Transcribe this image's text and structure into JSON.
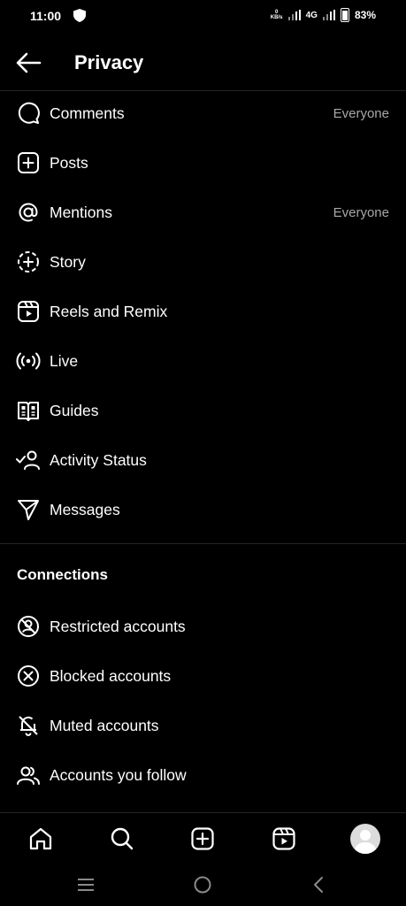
{
  "status_bar": {
    "time": "11:00",
    "net_speed_value": "0",
    "net_speed_unit": "KB/s",
    "network": "4G",
    "battery": "83%"
  },
  "header": {
    "title": "Privacy"
  },
  "items": [
    {
      "label": "Comments",
      "value": "Everyone",
      "icon": "comment-icon"
    },
    {
      "label": "Posts",
      "value": "",
      "icon": "add-post-icon"
    },
    {
      "label": "Mentions",
      "value": "Everyone",
      "icon": "at-icon"
    },
    {
      "label": "Story",
      "value": "",
      "icon": "story-icon"
    },
    {
      "label": "Reels and Remix",
      "value": "",
      "icon": "reels-icon"
    },
    {
      "label": "Live",
      "value": "",
      "icon": "live-icon"
    },
    {
      "label": "Guides",
      "value": "",
      "icon": "guides-icon"
    },
    {
      "label": "Activity Status",
      "value": "",
      "icon": "activity-status-icon"
    },
    {
      "label": "Messages",
      "value": "",
      "icon": "send-icon"
    }
  ],
  "connections": {
    "title": "Connections",
    "items": [
      {
        "label": "Restricted accounts",
        "icon": "restricted-icon"
      },
      {
        "label": "Blocked accounts",
        "icon": "blocked-icon"
      },
      {
        "label": "Muted accounts",
        "icon": "muted-icon"
      },
      {
        "label": "Accounts you follow",
        "icon": "people-icon"
      }
    ]
  },
  "bottom_tabs": [
    "home-icon",
    "search-icon",
    "create-icon",
    "reels-icon",
    "profile-avatar"
  ],
  "system_nav": [
    "recents-icon",
    "home-circle-icon",
    "back-icon"
  ]
}
